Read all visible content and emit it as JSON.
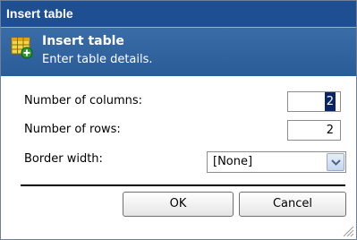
{
  "window": {
    "title": "Insert table"
  },
  "header": {
    "title": "Insert table",
    "subtitle": "Enter table details.",
    "icon": "table-add-icon"
  },
  "form": {
    "columns": {
      "label": "Number of columns:",
      "value": "2"
    },
    "rows": {
      "label": "Number of rows:",
      "value": "2"
    },
    "border": {
      "label": "Border width:",
      "selected": "[None]"
    }
  },
  "buttons": {
    "ok": "OK",
    "cancel": "Cancel"
  },
  "colors": {
    "titlebar": "#1f4f93",
    "header": "#3a6ca7",
    "selection": "#0a246a"
  }
}
